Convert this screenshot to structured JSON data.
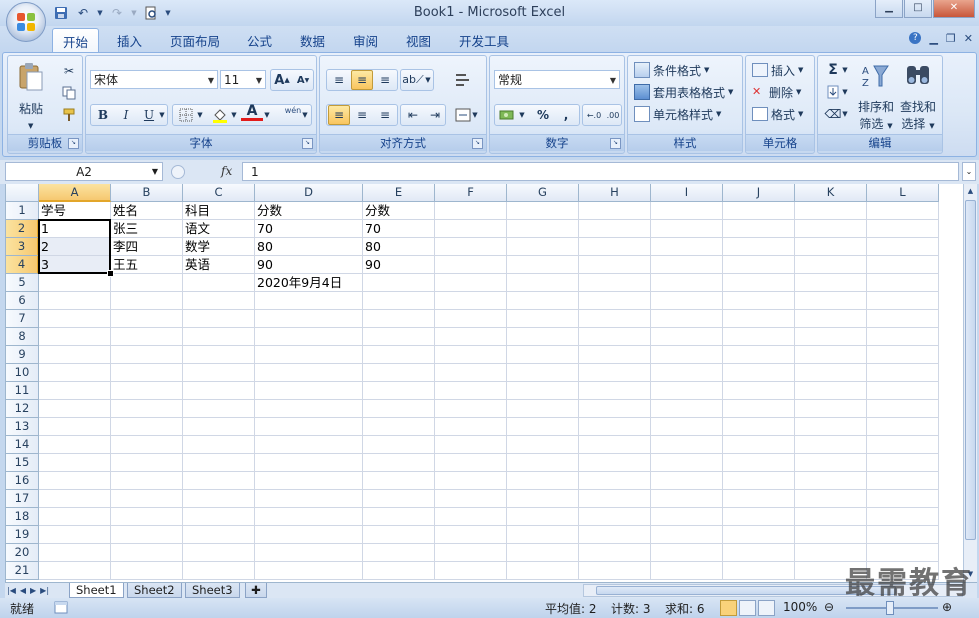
{
  "window": {
    "title": "Book1 - Microsoft Excel",
    "controls": [
      "▁",
      "□",
      "✕"
    ]
  },
  "tabs": [
    "开始",
    "插入",
    "页面布局",
    "公式",
    "数据",
    "审阅",
    "视图",
    "开发工具"
  ],
  "ribbon": {
    "clipboard": {
      "label": "剪贴板",
      "paste": "粘贴"
    },
    "font": {
      "label": "字体",
      "name": "宋体",
      "size": "11",
      "bold": "B",
      "italic": "I",
      "underline": "U",
      "font_color_glyph": "A",
      "phonetic_glyph": "wén"
    },
    "alignment": {
      "label": "对齐方式"
    },
    "number": {
      "label": "数字",
      "format": "常规",
      "percent": "%",
      "comma": ","
    },
    "styles": {
      "label": "样式",
      "conditional": "条件格式",
      "table": "套用表格格式",
      "cell": "单元格样式"
    },
    "cells": {
      "label": "单元格",
      "insert": "插入",
      "delete": "删除",
      "format": "格式"
    },
    "editing": {
      "label": "编辑",
      "sort_line1": "排序和",
      "sort_line2": "筛选",
      "find_line1": "查找和",
      "find_line2": "选择"
    }
  },
  "formula_bar": {
    "name_box": "A2",
    "fx": "fx",
    "content": "1"
  },
  "columns": [
    "A",
    "B",
    "C",
    "D",
    "E",
    "F",
    "G",
    "H",
    "I",
    "J",
    "K",
    "L"
  ],
  "rows": [
    [
      "学号",
      "姓名",
      "科目",
      "分数",
      "分数"
    ],
    [
      "1",
      "张三",
      "语文",
      "70",
      "70"
    ],
    [
      "2",
      "李四",
      "数学",
      "80",
      "80"
    ],
    [
      "3",
      "王五",
      "英语",
      "90",
      "90"
    ],
    [
      "",
      "",
      "",
      "2020年9月4日",
      ""
    ]
  ],
  "row_count": 21,
  "sheets": [
    "Sheet1",
    "Sheet2",
    "Sheet3"
  ],
  "status": {
    "mode": "就绪",
    "average": "平均值: 2",
    "count": "计数: 3",
    "sum": "求和: 6",
    "zoom": "100%"
  },
  "watermark": "最需教育",
  "colors": {
    "accent": "#15428b",
    "selection_header": "#f6c870",
    "selection_fill": "#e8edf6"
  }
}
